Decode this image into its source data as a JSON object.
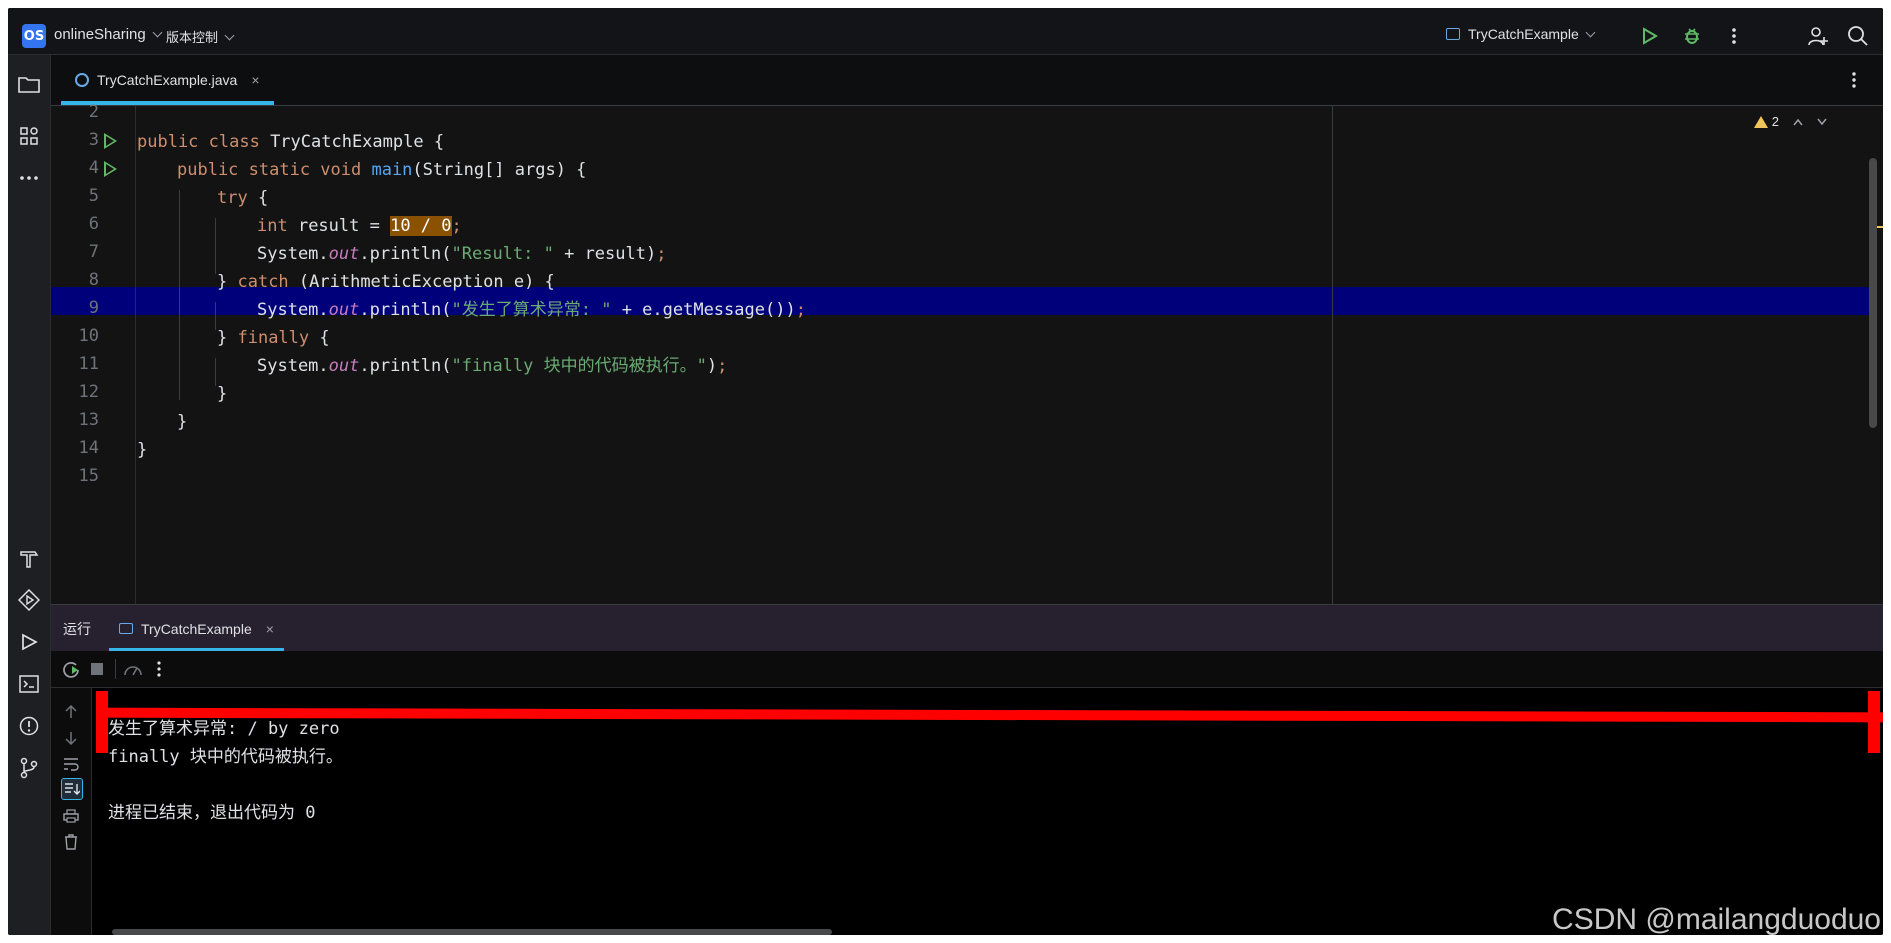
{
  "titlebar": {
    "project_badge": "OS",
    "project_name": "onlineSharing",
    "vcs_label": "版本控制",
    "run_config": "TryCatchExample"
  },
  "editor_tab": {
    "filename": "TryCatchExample.java",
    "close": "×"
  },
  "editor": {
    "warnings_count": "2",
    "line_numbers": [
      "2",
      "3",
      "4",
      "5",
      "6",
      "7",
      "8",
      "9",
      "10",
      "11",
      "12",
      "13",
      "14",
      "15"
    ],
    "code": {
      "l3_a": "public class ",
      "l3_b": "TryCatchExample {",
      "l4_a": "public static void ",
      "l4_b": "main",
      "l4_c": "(String[] args) {",
      "l5_a": "try",
      "l5_b": " {",
      "l6_a": "int",
      "l6_b": " result = ",
      "l6_c": "10 / 0",
      "l6_d": ";",
      "l7_a": "System.",
      "l7_b": "out",
      "l7_c": ".println(",
      "l7_d": "\"Result: \"",
      "l7_e": " + result)",
      "l7_f": ";",
      "l8_a": "} ",
      "l8_b": "catch",
      "l8_c": " (ArithmeticException e) {",
      "l9_a": "System.",
      "l9_b": "out",
      "l9_c": ".println(",
      "l9_d": "\"发生了算术异常: \"",
      "l9_e": " + e.getMessage())",
      "l9_f": ";",
      "l10_a": "} ",
      "l10_b": "finally",
      "l10_c": " {",
      "l11_a": "System.",
      "l11_b": "out",
      "l11_c": ".println(",
      "l11_d": "\"finally 块中的代码被执行。\"",
      "l11_e": ")",
      "l11_f": ";",
      "l12": "}",
      "l13": "}",
      "l14": "}"
    }
  },
  "run_panel": {
    "label": "运行",
    "tab_name": "TryCatchExample",
    "close": "×",
    "output": [
      "发生了算术异常: / by zero",
      "finally 块中的代码被执行。",
      "",
      "进程已结束，退出代码为 0"
    ]
  },
  "watermark": "CSDN @mailangduoduo",
  "colors": {
    "accent": "#35b6e8",
    "run_green": "#5fb865",
    "highlight_line": "#00007a",
    "warning": "#f2c55c"
  }
}
